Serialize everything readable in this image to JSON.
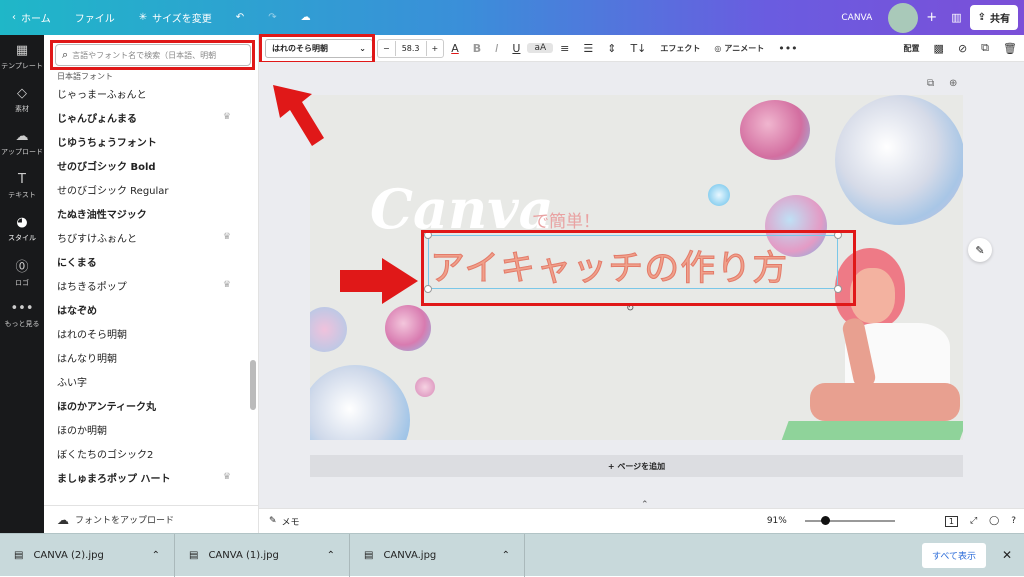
{
  "topbar": {
    "home": "ホーム",
    "file": "ファイル",
    "resize": "サイズを変更",
    "project_name": "CANVA",
    "share": "共有"
  },
  "sidebar": {
    "items": [
      {
        "label": "テンプレート",
        "icon": "template-icon"
      },
      {
        "label": "素材",
        "icon": "elements-icon"
      },
      {
        "label": "アップロード",
        "icon": "upload-icon"
      },
      {
        "label": "テキスト",
        "icon": "text-icon"
      },
      {
        "label": "スタイル",
        "icon": "style-icon"
      },
      {
        "label": "ロゴ",
        "icon": "logo-icon"
      },
      {
        "label": "もっと見る",
        "icon": "more-icon"
      }
    ]
  },
  "font_panel": {
    "search_placeholder": "言語やフォント名で検索（日本語、明朝",
    "section_label": "日本語フォント",
    "fonts": [
      {
        "name": "じゃっまーふぉんと",
        "pro": false
      },
      {
        "name": "じゃんぴょんまる",
        "pro": true
      },
      {
        "name": "じゆうちょうフォント",
        "pro": false
      },
      {
        "name": "せのびゴシック Bold",
        "pro": false
      },
      {
        "name": "せのびゴシック Regular",
        "pro": false
      },
      {
        "name": "たぬき油性マジック",
        "pro": false
      },
      {
        "name": "ちびすけふぉんと",
        "pro": true
      },
      {
        "name": "にくまる",
        "pro": false
      },
      {
        "name": "はちきるポップ",
        "pro": true
      },
      {
        "name": "はなぞめ",
        "pro": false
      },
      {
        "name": "はれのそら明朝",
        "pro": false
      },
      {
        "name": "はんなり明朝",
        "pro": false
      },
      {
        "name": "ふい字",
        "pro": false
      },
      {
        "name": "ほのかアンティーク丸",
        "pro": false
      },
      {
        "name": "ほのか明朝",
        "pro": false
      },
      {
        "name": "ぼくたちのゴシック2",
        "pro": false
      },
      {
        "name": "ましゅまろポップ ハート",
        "pro": true
      }
    ],
    "upload_label": "フォントをアップロード"
  },
  "toolbar": {
    "font_name": "はれのそら明朝",
    "font_size": "58.3",
    "minus": "−",
    "plus": "+",
    "effects": "エフェクト",
    "animate": "アニメート",
    "position": "配置"
  },
  "canvas": {
    "logo_text": "Canva",
    "subtitle": "で簡単！",
    "headline": "アイキャッチの作り方",
    "add_page": "+ ページを追加"
  },
  "statusbar": {
    "memo": "メモ",
    "zoom": "91%",
    "page_num": "1"
  },
  "downloads": {
    "files": [
      "CANVA (2).jpg",
      "CANVA (1).jpg",
      "CANVA.jpg"
    ],
    "show_all": "すべて表示"
  },
  "colors": {
    "annotation_red": "#e01818",
    "headline": "#f0a08a"
  }
}
